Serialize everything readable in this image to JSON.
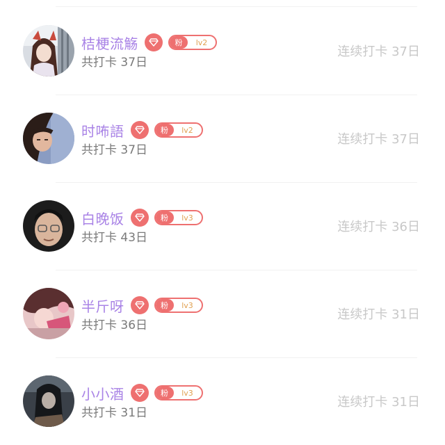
{
  "icons": {
    "vip": "diamond-icon"
  },
  "colors": {
    "name": "#a983e6",
    "badge": "#ee7070",
    "level": "#e0a050",
    "total": "#7a7a7a",
    "streak": "#c8c8c8"
  },
  "users": [
    {
      "name": "桔梗流觞",
      "fan_label": "粉",
      "level": "lv2",
      "total": "共打卡 37日",
      "streak": "连续打卡 37日"
    },
    {
      "name": "时咘語",
      "fan_label": "粉",
      "level": "lv2",
      "total": "共打卡 37日",
      "streak": "连续打卡 37日"
    },
    {
      "name": "白晚饭",
      "fan_label": "粉",
      "level": "lv3",
      "total": "共打卡 43日",
      "streak": "连续打卡 36日"
    },
    {
      "name": "半斤呀",
      "fan_label": "粉",
      "level": "lv3",
      "total": "共打卡 36日",
      "streak": "连续打卡 31日"
    },
    {
      "name": "小小酒",
      "fan_label": "粉",
      "level": "lv3",
      "total": "共打卡 31日",
      "streak": "连续打卡 31日"
    }
  ]
}
